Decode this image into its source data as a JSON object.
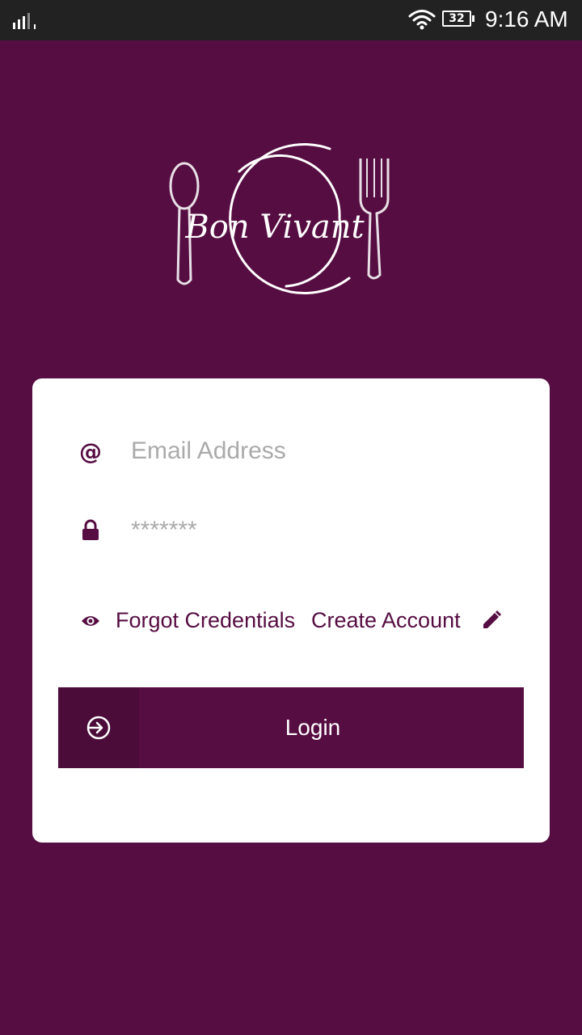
{
  "status_bar": {
    "battery": "32",
    "time": "9:16 AM"
  },
  "icons": {
    "signal": "signal-icon",
    "wifi": "wifi-icon",
    "battery": "battery-icon",
    "email": "at-icon",
    "password": "lock-icon",
    "forgot": "eye-icon",
    "create": "pencil-icon",
    "login": "login-arrow-icon"
  },
  "logo": {
    "text": "Bon Vivant"
  },
  "login_form": {
    "email_placeholder": "Email Address",
    "email_value": "",
    "password_placeholder": "*******",
    "password_value": "",
    "forgot_label": "Forgot Credentials",
    "create_label": "Create Account",
    "login_label": "Login"
  },
  "colors": {
    "brand": "#560d42",
    "brand_dark": "#4b0c3a",
    "status_bar": "#222222",
    "card": "#ffffff",
    "placeholder": "#aaaaaa"
  }
}
